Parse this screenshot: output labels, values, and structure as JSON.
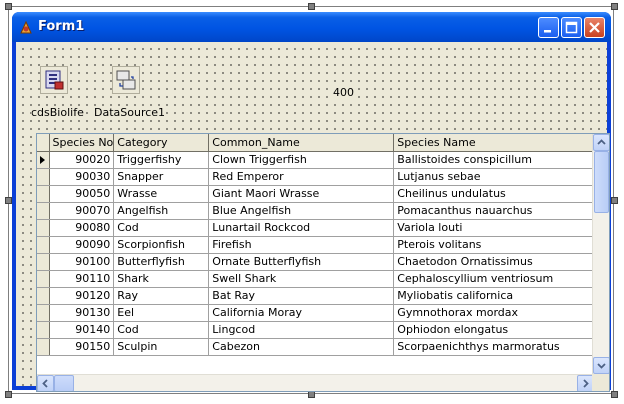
{
  "window": {
    "title": "Form1",
    "caption_icons": [
      "minimize-icon",
      "maximize-icon",
      "close-icon"
    ]
  },
  "components": {
    "dataset_label": "cdsBiolife",
    "datasource_label": "DataSource1",
    "dataset_icon": "client-dataset-icon",
    "datasource_icon": "datasource-icon"
  },
  "label400": "400",
  "grid": {
    "columns": [
      "Species No",
      "Category",
      "Common_Name",
      "Species Name"
    ],
    "rows": [
      {
        "species_no": "90020",
        "category": "Triggerfishy",
        "common_name": "Clown Triggerfish",
        "species_name": "Ballistoides conspicillum"
      },
      {
        "species_no": "90030",
        "category": "Snapper",
        "common_name": "Red Emperor",
        "species_name": "Lutjanus sebae"
      },
      {
        "species_no": "90050",
        "category": "Wrasse",
        "common_name": "Giant Maori Wrasse",
        "species_name": "Cheilinus undulatus"
      },
      {
        "species_no": "90070",
        "category": "Angelfish",
        "common_name": "Blue Angelfish",
        "species_name": "Pomacanthus nauarchus"
      },
      {
        "species_no": "90080",
        "category": "Cod",
        "common_name": "Lunartail Rockcod",
        "species_name": "Variola louti"
      },
      {
        "species_no": "90090",
        "category": "Scorpionfish",
        "common_name": "Firefish",
        "species_name": "Pterois volitans"
      },
      {
        "species_no": "90100",
        "category": "Butterflyfish",
        "common_name": "Ornate Butterflyfish",
        "species_name": "Chaetodon Ornatissimus"
      },
      {
        "species_no": "90110",
        "category": "Shark",
        "common_name": "Swell Shark",
        "species_name": "Cephaloscyllium ventriosum"
      },
      {
        "species_no": "90120",
        "category": "Ray",
        "common_name": "Bat Ray",
        "species_name": "Myliobatis californica"
      },
      {
        "species_no": "90130",
        "category": "Eel",
        "common_name": "California Moray",
        "species_name": "Gymnothorax mordax"
      },
      {
        "species_no": "90140",
        "category": "Cod",
        "common_name": "Lingcod",
        "species_name": "Ophiodon elongatus"
      },
      {
        "species_no": "90150",
        "category": "Sculpin",
        "common_name": "Cabezon",
        "species_name": "Scorpaenichthys marmoratus"
      }
    ],
    "current_row": 0
  },
  "colors": {
    "titlebar": "#0054e3",
    "form_background": "#ece9d8",
    "grid_background": "#ffffff"
  }
}
